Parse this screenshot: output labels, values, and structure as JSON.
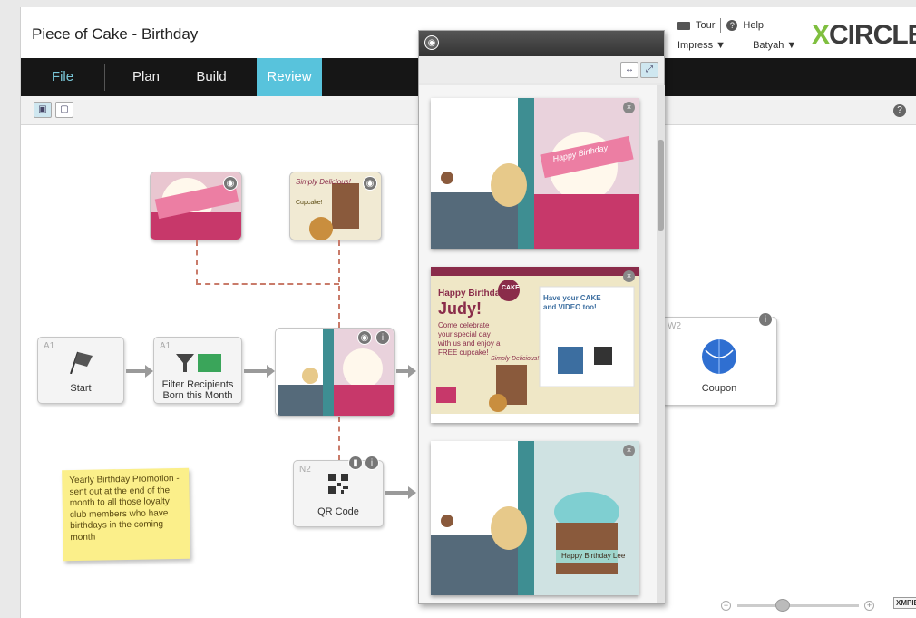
{
  "app": {
    "title": "Piece of Cake - Birthday"
  },
  "top": {
    "tour": "Tour",
    "help": "Help",
    "impress": "Impress ▼",
    "user": "Batyah ▼",
    "logo_x": "X",
    "logo_rest": "CIRCLE"
  },
  "nav": {
    "file": "File",
    "plan": "Plan",
    "build": "Build",
    "review": "Review"
  },
  "nodes": {
    "start": {
      "tag": "A1",
      "label": "Start"
    },
    "filter": {
      "tag": "A1",
      "label_line1": "Filter Recipients",
      "label_line2": "Born this Month"
    },
    "qr": {
      "tag": "N2",
      "label": "QR Code"
    },
    "coupon": {
      "tag": "W2",
      "label": "Coupon"
    }
  },
  "sticky": "Yearly Birthday Promotion - sent out at the end of the month to all those loyalty club members who have birthdays in the coming month",
  "cards": {
    "c2_happy": "Happy Birthday",
    "c2_name": "Judy!",
    "c2_body": "Come celebrate your special day with us and enjoy a FREE cupcake!",
    "c2_badge": "Simply Delicious!",
    "c2_right_title": "Have your CAKE and VIDEO too!",
    "c2_logo": "CAKE",
    "c3_text": "Happy Birthday Lee",
    "thumb2_text": "Simply Delicious!",
    "thumb2_sub": "Cupcake!",
    "card1_text": "Happy Birthday"
  },
  "footer": {
    "brand": "XMPIE"
  },
  "colors": {
    "accent": "#58c3dc",
    "nav_bg": "#161616",
    "card_teal": "#3e8e92",
    "card_maroon": "#8a2c4a"
  }
}
